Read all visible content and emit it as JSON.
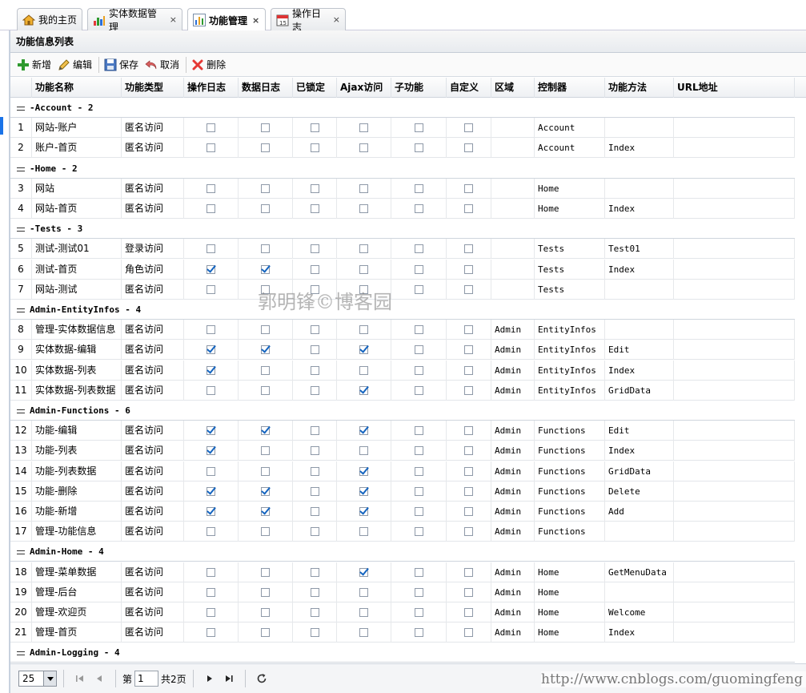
{
  "tabs": [
    {
      "label": "我的主页",
      "icon": "home-icon",
      "closable": false
    },
    {
      "label": "实体数据管理",
      "icon": "chart-icon",
      "closable": true
    },
    {
      "label": "功能管理",
      "icon": "bar-chart-icon",
      "closable": true,
      "active": true
    },
    {
      "label": "操作日志",
      "icon": "calendar-icon",
      "closable": true
    }
  ],
  "tab_close_glyph": "×",
  "panel": {
    "title": "功能信息列表"
  },
  "toolbar": {
    "add": "新增",
    "edit": "编辑",
    "save": "保存",
    "cancel": "取消",
    "delete": "删除"
  },
  "columns": [
    "功能名称",
    "功能类型",
    "操作日志",
    "数据日志",
    "已锁定",
    "Ajax访问",
    "子功能",
    "自定义",
    "区域",
    "控制器",
    "功能方法",
    "URL地址"
  ],
  "groups": [
    {
      "title": "-Account - 2",
      "rows": [
        {
          "n": "1",
          "name": "网站-账户",
          "type": "匿名访问",
          "checks": [
            0,
            0,
            0,
            0,
            0,
            0
          ],
          "area": "",
          "controller": "Account",
          "method": ""
        },
        {
          "n": "2",
          "name": "账户-首页",
          "type": "匿名访问",
          "checks": [
            0,
            0,
            0,
            0,
            0,
            0
          ],
          "area": "",
          "controller": "Account",
          "method": "Index"
        }
      ]
    },
    {
      "title": "-Home - 2",
      "rows": [
        {
          "n": "3",
          "name": "网站",
          "type": "匿名访问",
          "checks": [
            0,
            0,
            0,
            0,
            0,
            0
          ],
          "area": "",
          "controller": "Home",
          "method": ""
        },
        {
          "n": "4",
          "name": "网站-首页",
          "type": "匿名访问",
          "checks": [
            0,
            0,
            0,
            0,
            0,
            0
          ],
          "area": "",
          "controller": "Home",
          "method": "Index"
        }
      ]
    },
    {
      "title": "-Tests - 3",
      "rows": [
        {
          "n": "5",
          "name": "测试-测试01",
          "type": "登录访问",
          "checks": [
            0,
            0,
            0,
            0,
            0,
            0
          ],
          "area": "",
          "controller": "Tests",
          "method": "Test01"
        },
        {
          "n": "6",
          "name": "测试-首页",
          "type": "角色访问",
          "checks": [
            1,
            1,
            0,
            0,
            0,
            0
          ],
          "area": "",
          "controller": "Tests",
          "method": "Index"
        },
        {
          "n": "7",
          "name": "网站-测试",
          "type": "匿名访问",
          "checks": [
            0,
            0,
            0,
            0,
            0,
            0
          ],
          "area": "",
          "controller": "Tests",
          "method": ""
        }
      ]
    },
    {
      "title": "Admin-EntityInfos - 4",
      "rows": [
        {
          "n": "8",
          "name": "管理-实体数据信息",
          "type": "匿名访问",
          "checks": [
            0,
            0,
            0,
            0,
            0,
            0
          ],
          "area": "Admin",
          "controller": "EntityInfos",
          "method": ""
        },
        {
          "n": "9",
          "name": "实体数据-编辑",
          "type": "匿名访问",
          "checks": [
            1,
            1,
            0,
            1,
            0,
            0
          ],
          "area": "Admin",
          "controller": "EntityInfos",
          "method": "Edit"
        },
        {
          "n": "10",
          "name": "实体数据-列表",
          "type": "匿名访问",
          "checks": [
            1,
            0,
            0,
            0,
            0,
            0
          ],
          "area": "Admin",
          "controller": "EntityInfos",
          "method": "Index"
        },
        {
          "n": "11",
          "name": "实体数据-列表数据",
          "type": "匿名访问",
          "checks": [
            0,
            0,
            0,
            1,
            0,
            0
          ],
          "area": "Admin",
          "controller": "EntityInfos",
          "method": "GridData"
        }
      ]
    },
    {
      "title": "Admin-Functions - 6",
      "rows": [
        {
          "n": "12",
          "name": "功能-编辑",
          "type": "匿名访问",
          "checks": [
            1,
            1,
            0,
            1,
            0,
            0
          ],
          "area": "Admin",
          "controller": "Functions",
          "method": "Edit"
        },
        {
          "n": "13",
          "name": "功能-列表",
          "type": "匿名访问",
          "checks": [
            1,
            0,
            0,
            0,
            0,
            0
          ],
          "area": "Admin",
          "controller": "Functions",
          "method": "Index"
        },
        {
          "n": "14",
          "name": "功能-列表数据",
          "type": "匿名访问",
          "checks": [
            0,
            0,
            0,
            1,
            0,
            0
          ],
          "area": "Admin",
          "controller": "Functions",
          "method": "GridData"
        },
        {
          "n": "15",
          "name": "功能-删除",
          "type": "匿名访问",
          "checks": [
            1,
            1,
            0,
            1,
            0,
            0
          ],
          "area": "Admin",
          "controller": "Functions",
          "method": "Delete"
        },
        {
          "n": "16",
          "name": "功能-新增",
          "type": "匿名访问",
          "checks": [
            1,
            1,
            0,
            1,
            0,
            0
          ],
          "area": "Admin",
          "controller": "Functions",
          "method": "Add"
        },
        {
          "n": "17",
          "name": "管理-功能信息",
          "type": "匿名访问",
          "checks": [
            0,
            0,
            0,
            0,
            0,
            0
          ],
          "area": "Admin",
          "controller": "Functions",
          "method": ""
        }
      ]
    },
    {
      "title": "Admin-Home - 4",
      "rows": [
        {
          "n": "18",
          "name": "管理-菜单数据",
          "type": "匿名访问",
          "checks": [
            0,
            0,
            0,
            1,
            0,
            0
          ],
          "area": "Admin",
          "controller": "Home",
          "method": "GetMenuData"
        },
        {
          "n": "19",
          "name": "管理-后台",
          "type": "匿名访问",
          "checks": [
            0,
            0,
            0,
            0,
            0,
            0
          ],
          "area": "Admin",
          "controller": "Home",
          "method": ""
        },
        {
          "n": "20",
          "name": "管理-欢迎页",
          "type": "匿名访问",
          "checks": [
            0,
            0,
            0,
            0,
            0,
            0
          ],
          "area": "Admin",
          "controller": "Home",
          "method": "Welcome"
        },
        {
          "n": "21",
          "name": "管理-首页",
          "type": "匿名访问",
          "checks": [
            0,
            0,
            0,
            0,
            0,
            0
          ],
          "area": "Admin",
          "controller": "Home",
          "method": "Index"
        }
      ]
    },
    {
      "title": "Admin-Logging - 4",
      "rows": []
    }
  ],
  "watermark": "郭明锋©博客园",
  "pager": {
    "page_size": "25",
    "page_prefix": "第",
    "current_page": "1",
    "page_total": "共2页"
  },
  "url_watermark": "http://www.cnblogs.com/guomingfeng",
  "colors": {
    "check_accent": "#1565c0",
    "add_icon": "#2e9a2e",
    "delete_icon": "#e53935",
    "left_marker": "#1a73e8"
  }
}
